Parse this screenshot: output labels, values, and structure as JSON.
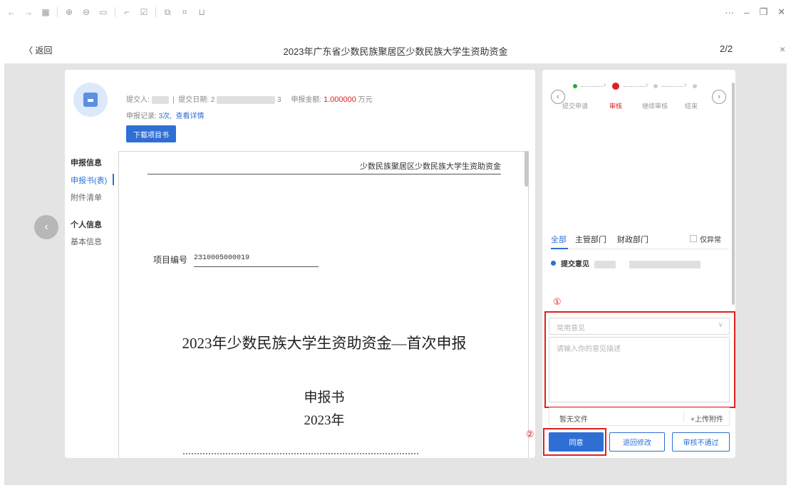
{
  "toolbar": {
    "icons": [
      "back-icon",
      "forward-icon",
      "grid-icon",
      "zoom-in-icon",
      "zoom-out-icon",
      "fit-icon",
      "crop-icon",
      "edit-icon",
      "copy-icon",
      "scan-icon",
      "save-icon"
    ],
    "more": "···",
    "minimize": "–",
    "restore": "❐",
    "close": "✕"
  },
  "header": {
    "back_label": "〈 返回",
    "title": "2023年广东省少数民族聚居区少数民族大学生资助资金",
    "page_counter": "2/2",
    "close": "×"
  },
  "info": {
    "submitter_label": "提交人:",
    "submit_date_label": "提交日期: 2",
    "date_tail": "3",
    "amount_label": "申报金额:",
    "amount_value": "1.000000",
    "amount_unit": "万元",
    "record_label": "申报记录:",
    "record_count": "3次,",
    "record_link": "查看详情",
    "download_button": "下载项目书"
  },
  "side_nav": {
    "section1": "申报信息",
    "item1": "申报书(表)",
    "item2": "附件清单",
    "section2": "个人信息",
    "item3": "基本信息"
  },
  "document": {
    "header_text": "少数民族聚居区少数民族大学生资助资金",
    "project_no_label": "项目编号",
    "project_no_value": "2310005000019",
    "title": "2023年少数民族大学生资助资金—首次申报",
    "subtitle": "申报书",
    "year": "2023年"
  },
  "workflow": {
    "steps": [
      "提交申请",
      "审核",
      "继续审核",
      "结束"
    ],
    "current_index": 1,
    "colors": {
      "done": "#19b03a",
      "current": "#e02020",
      "pending": "#cccccc"
    }
  },
  "opinion": {
    "tabs": [
      "全部",
      "主管部门",
      "财政部门"
    ],
    "only_abnormal": "仅异常",
    "timeline_entry": "提交意见",
    "common_opinion_placeholder": "常用意见",
    "description_placeholder": "请输入你的意见描述",
    "no_file": "暂无文件",
    "upload": "+上传附件"
  },
  "actions": {
    "agree": "同意",
    "return": "退回修改",
    "reject": "审核不通过"
  },
  "annotations": {
    "one": "①",
    "two": "②"
  },
  "colors": {
    "accent": "#2f6fd4",
    "danger": "#e02020",
    "background": "#e4e4e4"
  }
}
